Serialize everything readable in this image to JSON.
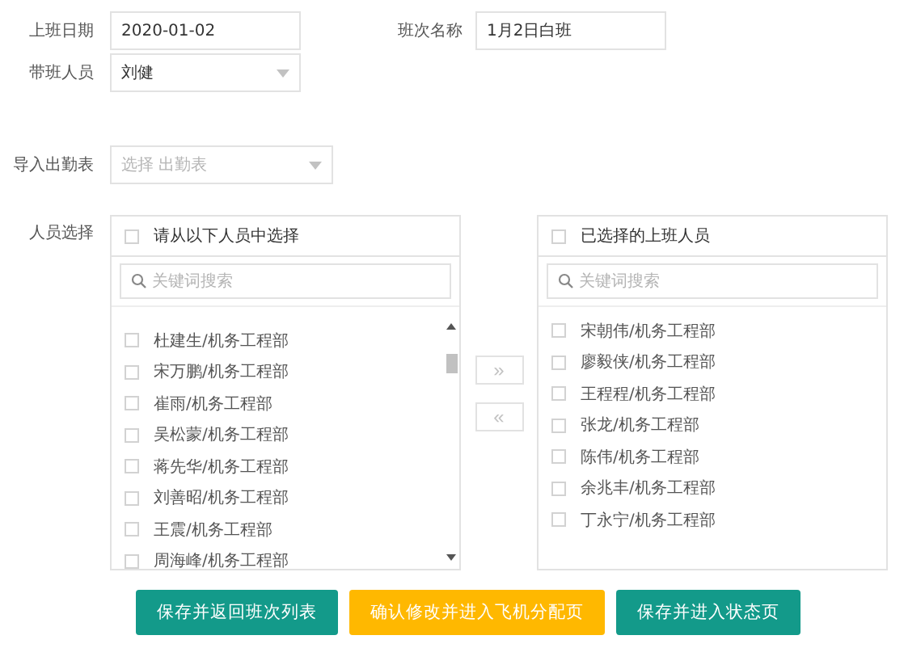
{
  "form": {
    "shift_date": {
      "label": "上班日期",
      "value": "2020-01-02"
    },
    "shift_name": {
      "label": "班次名称",
      "value": "1月2日白班"
    },
    "leader": {
      "label": "带班人员",
      "value": "刘健"
    },
    "attendance": {
      "label": "导入出勤表",
      "placeholder": "选择 出勤表"
    }
  },
  "staff_label": "人员选择",
  "available": {
    "title": "请从以下人员中选择",
    "checked": false,
    "search_placeholder": "关键词搜索",
    "items": [
      {
        "label": "杜建生/机务工程部",
        "checked": false
      },
      {
        "label": "宋万鹏/机务工程部",
        "checked": false
      },
      {
        "label": "崔雨/机务工程部",
        "checked": false
      },
      {
        "label": "吴松蒙/机务工程部",
        "checked": false
      },
      {
        "label": "蒋先华/机务工程部",
        "checked": false
      },
      {
        "label": "刘善昭/机务工程部",
        "checked": false
      },
      {
        "label": "王震/机务工程部",
        "checked": false
      },
      {
        "label": "周海峰/机务工程部",
        "checked": false
      }
    ]
  },
  "transfer_buttons": [
    {
      "label": "»",
      "disabled": true
    },
    {
      "label": "«",
      "disabled": true
    }
  ],
  "selected": {
    "title": "已选择的上班人员",
    "checked": false,
    "search_placeholder": "关键词搜索",
    "items": [
      {
        "label": "宋朝伟/机务工程部",
        "checked": false
      },
      {
        "label": "廖毅侠/机务工程部",
        "checked": false
      },
      {
        "label": "王程程/机务工程部",
        "checked": false
      },
      {
        "label": "张龙/机务工程部",
        "checked": false
      },
      {
        "label": "陈伟/机务工程部",
        "checked": false
      },
      {
        "label": "余兆丰/机务工程部",
        "checked": false
      },
      {
        "label": "丁永宁/机务工程部",
        "checked": false
      }
    ]
  },
  "actions": [
    {
      "label": "保存并返回班次列表",
      "kind": "primary"
    },
    {
      "label": "确认修改并进入飞机分配页",
      "kind": "warning"
    },
    {
      "label": "保存并进入状态页",
      "kind": "primary"
    }
  ]
}
